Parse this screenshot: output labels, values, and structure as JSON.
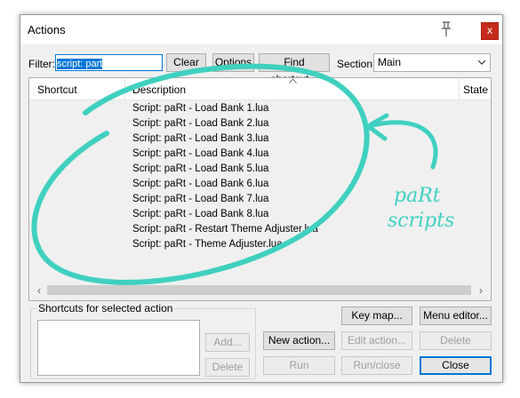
{
  "window": {
    "title": "Actions",
    "close_symbol": "x"
  },
  "filter": {
    "label": "Filter:",
    "value": "script: part"
  },
  "toolbar": {
    "clear_label": "Clear",
    "options_label": "Options",
    "find_shortcut_label": "Find shortcut..."
  },
  "section": {
    "label": "Section:",
    "selected": "Main"
  },
  "list": {
    "columns": [
      "Shortcut",
      "Description",
      "State"
    ],
    "rows": [
      "Script: paRt - Load Bank 1.lua",
      "Script: paRt - Load Bank 2.lua",
      "Script: paRt - Load Bank 3.lua",
      "Script: paRt - Load Bank 4.lua",
      "Script: paRt - Load Bank 5.lua",
      "Script: paRt - Load Bank 6.lua",
      "Script: paRt - Load Bank 7.lua",
      "Script: paRt - Load Bank 8.lua",
      "Script: paRt - Restart Theme Adjuster.lua",
      "Script: paRt - Theme Adjuster.lua"
    ]
  },
  "shortcuts_group": {
    "title": "Shortcuts for selected action",
    "add_label": "Add...",
    "delete_label": "Delete"
  },
  "actions": {
    "keymap_label": "Key map...",
    "menu_editor_label": "Menu editor...",
    "new_action_label": "New action...",
    "edit_action_label": "Edit action...",
    "delete_label": "Delete",
    "run_label": "Run",
    "run_close_label": "Run/close",
    "close_label": "Close"
  },
  "annotation": {
    "line1": "paRt",
    "line2": "scripts",
    "color": "#40d0c0"
  },
  "colors": {
    "accent": "#0078d7",
    "close": "#c42b1c"
  }
}
